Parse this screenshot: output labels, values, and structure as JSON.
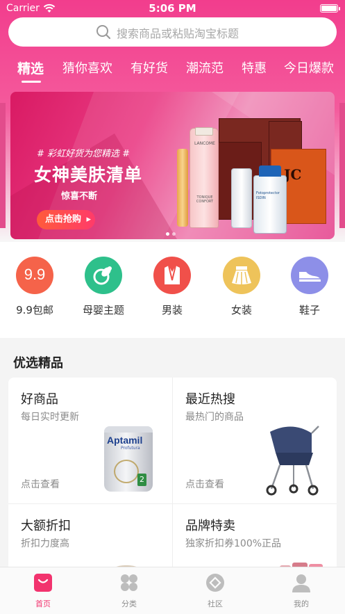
{
  "status_bar": {
    "carrier": "Carrier",
    "time": "5:06 PM"
  },
  "search": {
    "placeholder": "搜索商品或粘贴淘宝标题"
  },
  "tabs": [
    {
      "label": "精选",
      "active": true
    },
    {
      "label": "猜你喜欢"
    },
    {
      "label": "有好货"
    },
    {
      "label": "潮流范"
    },
    {
      "label": "特惠"
    },
    {
      "label": "今日爆款"
    }
  ],
  "banner": {
    "hashtag": "# 彩虹好货为您精选 #",
    "title": "女神美肤清单",
    "subtitle": "惊喜不断",
    "button": "点击抢购",
    "slide_count": 2,
    "active_slide": 1,
    "product_brand_1": "LANCOME",
    "product_name_1": "TONIQUE CONFORT",
    "product_brand_2": "Fotoprotector ISDIN",
    "product_brand_3": "JC"
  },
  "categories": [
    {
      "label": "9.9包邮",
      "icon": "nine-nine-icon",
      "color": "#f5634a"
    },
    {
      "label": "母婴主题",
      "icon": "pacifier-icon",
      "color": "#2ec08b"
    },
    {
      "label": "男装",
      "icon": "suit-icon",
      "color": "#f0504a"
    },
    {
      "label": "女装",
      "icon": "skirt-icon",
      "color": "#eec35a"
    },
    {
      "label": "鞋子",
      "icon": "shoe-icon",
      "color": "#8d8fe8"
    }
  ],
  "categories_icon_text": "9.9",
  "section": {
    "title": "优选精品"
  },
  "featured": [
    {
      "title": "好商品",
      "subtitle": "每日实时更新",
      "link": "点击查看",
      "image": "aptamil-can"
    },
    {
      "title": "最近热搜",
      "subtitle": "最热门的商品",
      "link": "点击查看",
      "image": "stroller"
    },
    {
      "title": "大额折扣",
      "subtitle": "折扣力度高"
    },
    {
      "title": "品牌特卖",
      "subtitle": "独家折扣券100%正品"
    }
  ],
  "aptamil": {
    "brand": "Aptamil",
    "line": "Profutura",
    "stage": "2"
  },
  "tabbar": [
    {
      "label": "首页",
      "icon": "home-bag-icon",
      "active": true
    },
    {
      "label": "分类",
      "icon": "grid-icon"
    },
    {
      "label": "社区",
      "icon": "community-icon"
    },
    {
      "label": "我的",
      "icon": "user-icon"
    }
  ],
  "colors": {
    "accent": "#f2336e",
    "header": "#f23d8d"
  }
}
